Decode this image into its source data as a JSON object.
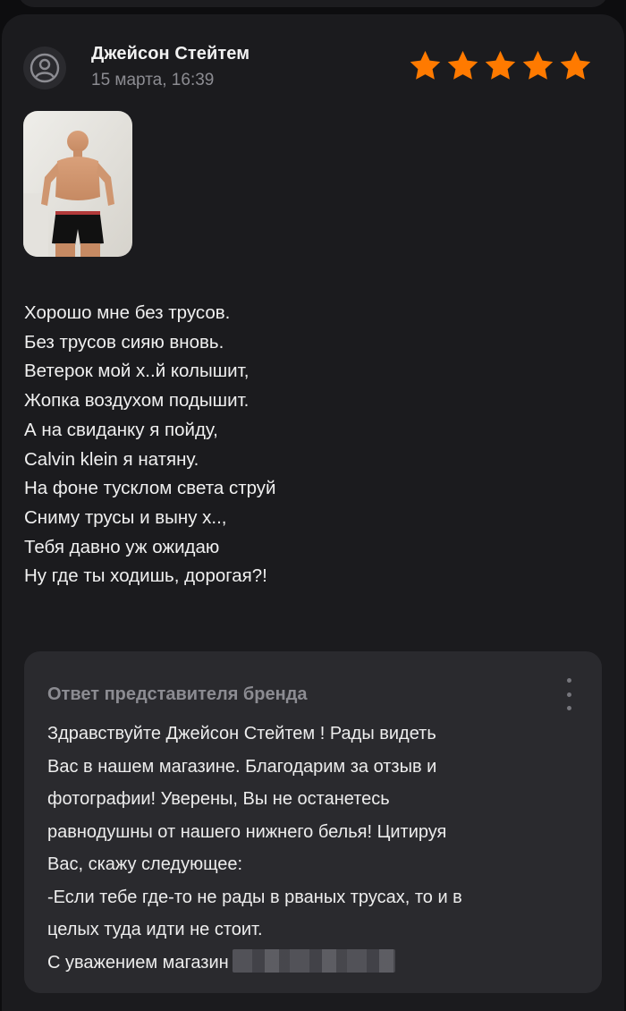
{
  "review": {
    "author": "Джейсон Стейтем",
    "date": "15 марта, 16:39",
    "rating": 5,
    "star_color": "#ff7a00",
    "avatar_icon": "user-circle-icon",
    "photo_description_icon": "photo-thumbnail",
    "text_lines": [
      "Хорошо мне без трусов.",
      "Без трусов сияю вновь.",
      "Ветерок мой х..й колышит,",
      "Жопка воздухом подышит.",
      "А на свиданку я пойду,",
      "Calvin klein я натяну.",
      "На фоне тусклом света струй",
      "Сниму трусы и выну х..,",
      "Тебя давно уж ожидаю",
      "Ну где ты ходишь, дорогая?!"
    ]
  },
  "reply": {
    "title": "Ответ представителя бренда",
    "menu_icon": "more-vertical-icon",
    "lines": [
      "Здравствуйте Джейсон Стейтем ! Рады видеть",
      "Вас в нашем магазине. Благодарим за отзыв и",
      "фотографии!  Уверены, Вы не останетесь",
      "равнодушны от нашего нижнего белья! Цитируя",
      "Вас, скажу следующее:",
      "-Если тебе где-то не рады в рваных трусах, то и в",
      "целых туда идти не стоит."
    ],
    "signature": "С уважением магазин"
  }
}
